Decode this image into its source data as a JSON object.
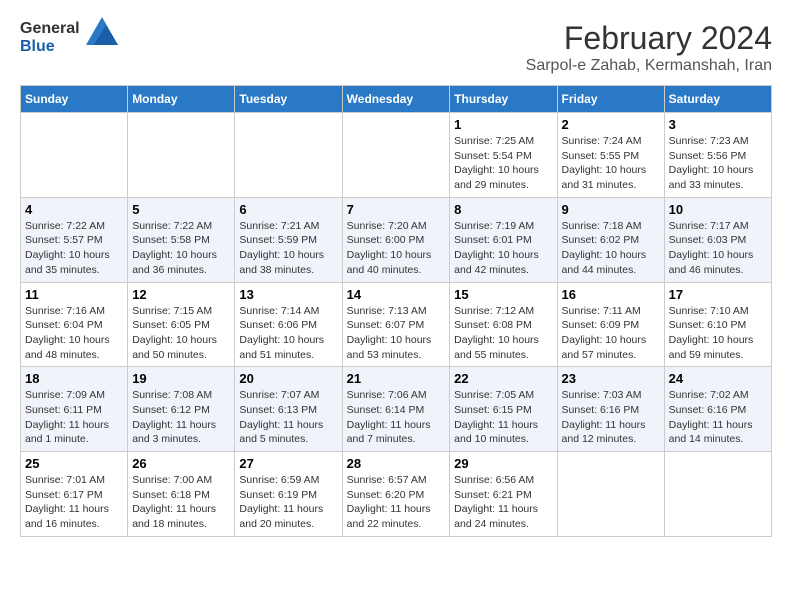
{
  "header": {
    "logo_line1": "General",
    "logo_line2": "Blue",
    "main_title": "February 2024",
    "subtitle": "Sarpol-e Zahab, Kermanshah, Iran"
  },
  "calendar": {
    "days_of_week": [
      "Sunday",
      "Monday",
      "Tuesday",
      "Wednesday",
      "Thursday",
      "Friday",
      "Saturday"
    ],
    "weeks": [
      [
        {
          "day": "",
          "info": ""
        },
        {
          "day": "",
          "info": ""
        },
        {
          "day": "",
          "info": ""
        },
        {
          "day": "",
          "info": ""
        },
        {
          "day": "1",
          "info": "Sunrise: 7:25 AM\nSunset: 5:54 PM\nDaylight: 10 hours\nand 29 minutes."
        },
        {
          "day": "2",
          "info": "Sunrise: 7:24 AM\nSunset: 5:55 PM\nDaylight: 10 hours\nand 31 minutes."
        },
        {
          "day": "3",
          "info": "Sunrise: 7:23 AM\nSunset: 5:56 PM\nDaylight: 10 hours\nand 33 minutes."
        }
      ],
      [
        {
          "day": "4",
          "info": "Sunrise: 7:22 AM\nSunset: 5:57 PM\nDaylight: 10 hours\nand 35 minutes."
        },
        {
          "day": "5",
          "info": "Sunrise: 7:22 AM\nSunset: 5:58 PM\nDaylight: 10 hours\nand 36 minutes."
        },
        {
          "day": "6",
          "info": "Sunrise: 7:21 AM\nSunset: 5:59 PM\nDaylight: 10 hours\nand 38 minutes."
        },
        {
          "day": "7",
          "info": "Sunrise: 7:20 AM\nSunset: 6:00 PM\nDaylight: 10 hours\nand 40 minutes."
        },
        {
          "day": "8",
          "info": "Sunrise: 7:19 AM\nSunset: 6:01 PM\nDaylight: 10 hours\nand 42 minutes."
        },
        {
          "day": "9",
          "info": "Sunrise: 7:18 AM\nSunset: 6:02 PM\nDaylight: 10 hours\nand 44 minutes."
        },
        {
          "day": "10",
          "info": "Sunrise: 7:17 AM\nSunset: 6:03 PM\nDaylight: 10 hours\nand 46 minutes."
        }
      ],
      [
        {
          "day": "11",
          "info": "Sunrise: 7:16 AM\nSunset: 6:04 PM\nDaylight: 10 hours\nand 48 minutes."
        },
        {
          "day": "12",
          "info": "Sunrise: 7:15 AM\nSunset: 6:05 PM\nDaylight: 10 hours\nand 50 minutes."
        },
        {
          "day": "13",
          "info": "Sunrise: 7:14 AM\nSunset: 6:06 PM\nDaylight: 10 hours\nand 51 minutes."
        },
        {
          "day": "14",
          "info": "Sunrise: 7:13 AM\nSunset: 6:07 PM\nDaylight: 10 hours\nand 53 minutes."
        },
        {
          "day": "15",
          "info": "Sunrise: 7:12 AM\nSunset: 6:08 PM\nDaylight: 10 hours\nand 55 minutes."
        },
        {
          "day": "16",
          "info": "Sunrise: 7:11 AM\nSunset: 6:09 PM\nDaylight: 10 hours\nand 57 minutes."
        },
        {
          "day": "17",
          "info": "Sunrise: 7:10 AM\nSunset: 6:10 PM\nDaylight: 10 hours\nand 59 minutes."
        }
      ],
      [
        {
          "day": "18",
          "info": "Sunrise: 7:09 AM\nSunset: 6:11 PM\nDaylight: 11 hours\nand 1 minute."
        },
        {
          "day": "19",
          "info": "Sunrise: 7:08 AM\nSunset: 6:12 PM\nDaylight: 11 hours\nand 3 minutes."
        },
        {
          "day": "20",
          "info": "Sunrise: 7:07 AM\nSunset: 6:13 PM\nDaylight: 11 hours\nand 5 minutes."
        },
        {
          "day": "21",
          "info": "Sunrise: 7:06 AM\nSunset: 6:14 PM\nDaylight: 11 hours\nand 7 minutes."
        },
        {
          "day": "22",
          "info": "Sunrise: 7:05 AM\nSunset: 6:15 PM\nDaylight: 11 hours\nand 10 minutes."
        },
        {
          "day": "23",
          "info": "Sunrise: 7:03 AM\nSunset: 6:16 PM\nDaylight: 11 hours\nand 12 minutes."
        },
        {
          "day": "24",
          "info": "Sunrise: 7:02 AM\nSunset: 6:16 PM\nDaylight: 11 hours\nand 14 minutes."
        }
      ],
      [
        {
          "day": "25",
          "info": "Sunrise: 7:01 AM\nSunset: 6:17 PM\nDaylight: 11 hours\nand 16 minutes."
        },
        {
          "day": "26",
          "info": "Sunrise: 7:00 AM\nSunset: 6:18 PM\nDaylight: 11 hours\nand 18 minutes."
        },
        {
          "day": "27",
          "info": "Sunrise: 6:59 AM\nSunset: 6:19 PM\nDaylight: 11 hours\nand 20 minutes."
        },
        {
          "day": "28",
          "info": "Sunrise: 6:57 AM\nSunset: 6:20 PM\nDaylight: 11 hours\nand 22 minutes."
        },
        {
          "day": "29",
          "info": "Sunrise: 6:56 AM\nSunset: 6:21 PM\nDaylight: 11 hours\nand 24 minutes."
        },
        {
          "day": "",
          "info": ""
        },
        {
          "day": "",
          "info": ""
        }
      ]
    ]
  }
}
